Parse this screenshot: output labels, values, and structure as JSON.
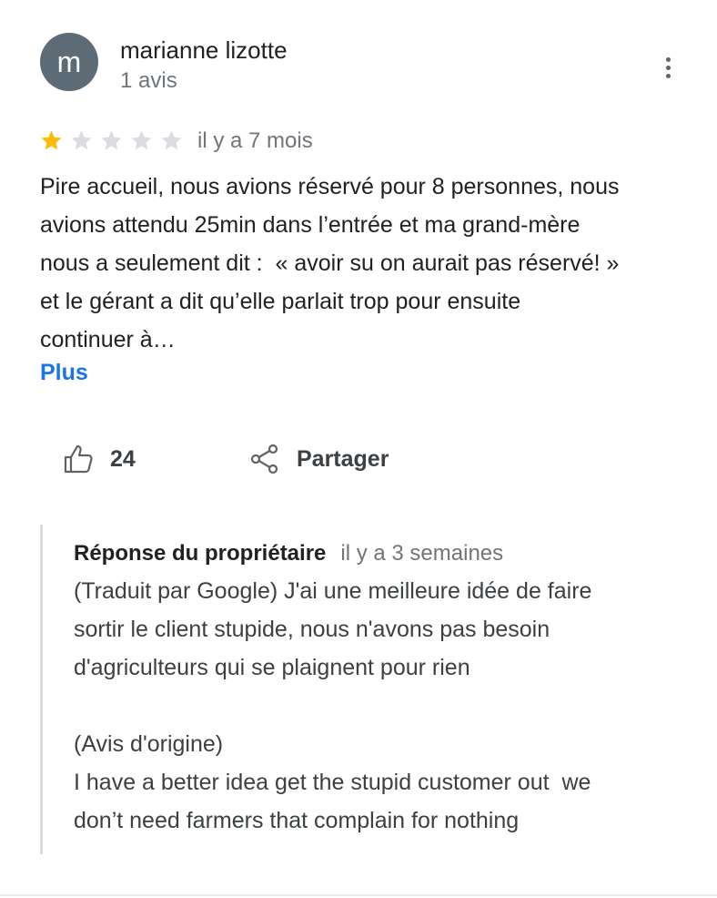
{
  "review": {
    "author": {
      "initial": "m",
      "name": "marianne lizotte",
      "review_count": "1 avis",
      "avatar_color": "#5c6b76"
    },
    "rating": {
      "value": 1,
      "max": 5,
      "filled_color": "#fbbc04",
      "empty_color": "#dadce0"
    },
    "time": "il y a 7 mois",
    "text_lines": [
      "Pire accueil, nous avions réservé pour 8 personnes, nous",
      "avions attendu 25min dans l’entrée et ma grand-mère",
      "nous a seulement dit :  « avoir su on aurait pas réservé! »",
      "et le gérant a dit qu’elle parlait trop pour ensuite",
      "continuer à…"
    ],
    "more_label": "Plus",
    "likes": "24",
    "share_label": "Partager",
    "icons": {
      "menu": "more-vert-icon",
      "like": "thumb-up-icon",
      "share": "share-icon",
      "star": "star-icon"
    }
  },
  "owner_response": {
    "label": "Réponse du propriétaire",
    "time": "il y a 3 semaines",
    "translated_lines": [
      "(Traduit par Google) J'ai une meilleure idée de faire",
      "sortir le client stupide, nous n'avons pas besoin",
      "d'agriculteurs qui se plaignent pour rien"
    ],
    "original_header": "(Avis d'origine)",
    "original_lines": [
      "I have a better idea get the stupid customer out  we",
      "don’t need farmers that complain for nothing"
    ]
  }
}
